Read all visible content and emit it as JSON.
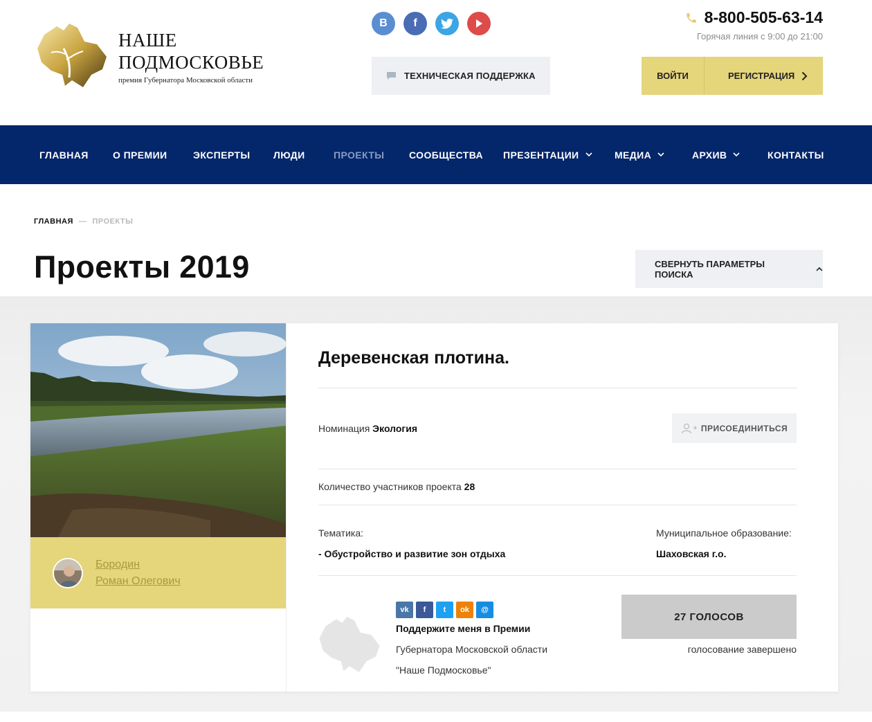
{
  "header": {
    "logo_title_line1": "НАШЕ",
    "logo_title_line2": "ПОДМОСКОВЬЕ",
    "logo_subtitle": "премия Губернатора Московской области",
    "social": [
      {
        "name": "vk",
        "glyph": "В",
        "color": "#5b8ed1"
      },
      {
        "name": "facebook",
        "glyph": "f",
        "color": "#4a6cb5"
      },
      {
        "name": "twitter",
        "glyph": "t",
        "color": "#3ca5e3"
      },
      {
        "name": "youtube",
        "glyph": "▶",
        "color": "#dd4b4b"
      }
    ],
    "support_label": "ТЕХНИЧЕСКАЯ ПОДДЕРЖКА",
    "phone": "8-800-505-63-14",
    "hotline": "Горячая линия с 9:00 до 21:00",
    "login_label": "ВОЙТИ",
    "register_label": "РЕГИСТРАЦИЯ",
    "accent_color": "#e5d57b"
  },
  "nav": {
    "background": "#04266b",
    "items": [
      {
        "label": "ГЛАВНАЯ"
      },
      {
        "label": "О ПРЕМИИ"
      },
      {
        "label": "ЭКСПЕРТЫ"
      },
      {
        "label": "ЛЮДИ"
      },
      {
        "label": "ПРОЕКТЫ",
        "active": true
      },
      {
        "label": "СООБЩЕСТВА"
      },
      {
        "label": "ПРЕЗЕНТАЦИИ",
        "dropdown": true
      },
      {
        "label": "МЕДИА",
        "dropdown": true
      },
      {
        "label": "АРХИВ",
        "dropdown": true
      },
      {
        "label": "КОНТАКТЫ"
      }
    ]
  },
  "breadcrumb": {
    "home": "ГЛАВНАЯ",
    "separator": "—",
    "current": "ПРОЕКТЫ"
  },
  "page": {
    "title": "Проекты 2019",
    "collapse_label": "СВЕРНУТЬ ПАРАМЕТРЫ ПОИСКА"
  },
  "project": {
    "author_line1": "Бородин",
    "author_line2": "Роман Олегович",
    "title": "Деревенская плотина.",
    "nomination_label": "Номинация",
    "nomination_value": "Экология",
    "join_label": "ПРИСОЕДИНИТЬСЯ",
    "participants_label": "Количество участников проекта",
    "participants_value": "28",
    "theme_label": "Тематика:",
    "theme_value": "- Обустройство и развитие зон отдыха",
    "municipality_label": "Муниципальное образование:",
    "municipality_value": "Шаховская г.о.",
    "share_icons": [
      {
        "name": "vk",
        "glyph": "vk",
        "color": "#4a76a8"
      },
      {
        "name": "facebook",
        "glyph": "f",
        "color": "#3b5998"
      },
      {
        "name": "twitter",
        "glyph": "t",
        "color": "#1da1f2"
      },
      {
        "name": "odnoklassniki",
        "glyph": "ok",
        "color": "#ee8208"
      },
      {
        "name": "mailru",
        "glyph": "@",
        "color": "#168de2"
      }
    ],
    "support_line1": "Поддержите меня в Премии",
    "support_line2": "Губернатора Московской области",
    "support_line3": "\"Наше Подмосковье\"",
    "votes_label": "27 ГОЛОСОВ",
    "vote_status": "голосование завершено"
  }
}
